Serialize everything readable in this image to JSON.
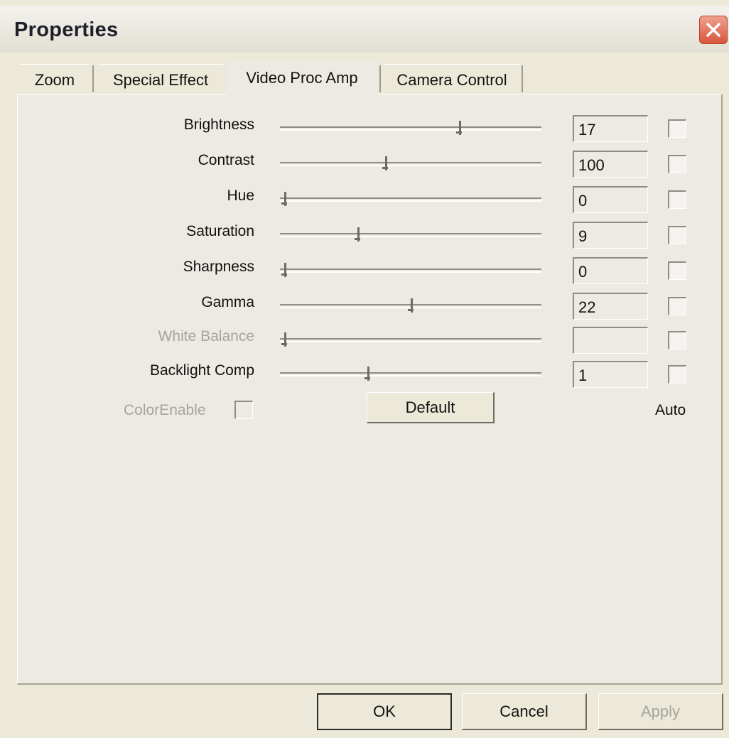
{
  "window": {
    "title": "Properties"
  },
  "tabs": [
    {
      "label": "Zoom"
    },
    {
      "label": "Special Effect"
    },
    {
      "label": "Video Proc Amp"
    },
    {
      "label": "Camera Control"
    }
  ],
  "rows": [
    {
      "label": "Brightness",
      "value": "17",
      "slider_fraction": 0.69,
      "auto_checked": false,
      "enabled": true
    },
    {
      "label": "Contrast",
      "value": "100",
      "slider_fraction": 0.4,
      "auto_checked": false,
      "enabled": true
    },
    {
      "label": "Hue",
      "value": "0",
      "slider_fraction": 0.0,
      "auto_checked": false,
      "enabled": true
    },
    {
      "label": "Saturation",
      "value": "9",
      "slider_fraction": 0.29,
      "auto_checked": false,
      "enabled": true
    },
    {
      "label": "Sharpness",
      "value": "0",
      "slider_fraction": 0.0,
      "auto_checked": false,
      "enabled": true
    },
    {
      "label": "Gamma",
      "value": "22",
      "slider_fraction": 0.5,
      "auto_checked": false,
      "enabled": true
    },
    {
      "label": "White Balance",
      "value": "",
      "slider_fraction": 0.0,
      "auto_checked": false,
      "enabled": false
    },
    {
      "label": "Backlight Comp",
      "value": "1",
      "slider_fraction": 0.33,
      "auto_checked": false,
      "enabled": true
    }
  ],
  "color_enable": {
    "label": "ColorEnable",
    "checked": false,
    "enabled": false
  },
  "default_button": {
    "label": "Default"
  },
  "auto_header": "Auto",
  "footer": {
    "ok_label": "OK",
    "cancel_label": "Cancel",
    "apply_label": "Apply"
  },
  "colors": {
    "close_button": "#d8553b",
    "face": "#ece9d8",
    "disabled_text": "#a7a59b"
  }
}
